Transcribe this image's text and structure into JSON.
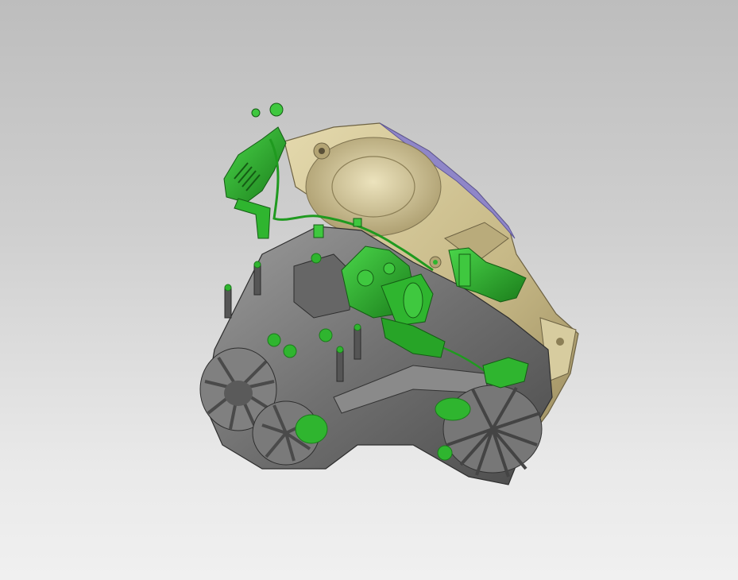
{
  "viewport": {
    "background_top": "#bdbdbd",
    "background_bottom": "#f0f0f0"
  },
  "model": {
    "colors": {
      "bell_housing": "#cdbf8e",
      "bell_housing_dark": "#9e8f62",
      "gearbox_case": "#6f6f6f",
      "gearbox_case_dark": "#4a4a4a",
      "gearbox_case_light": "#9a9a9a",
      "actuators": "#2fb52f",
      "actuators_dark": "#1c7a1c",
      "gasket": "#8f86c8"
    }
  }
}
